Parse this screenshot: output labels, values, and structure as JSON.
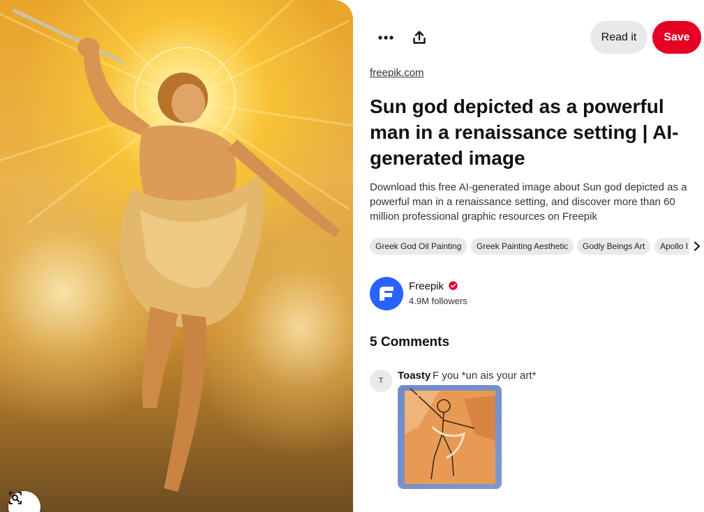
{
  "pin": {
    "image_icon": "sun-god-painting",
    "lens_icon": "visual-search-icon"
  },
  "toolbar": {
    "more_icon": "more-horizontal-icon",
    "share_icon": "share-upload-icon",
    "read_label": "Read it",
    "save_label": "Save"
  },
  "source": {
    "domain": "freepik.com"
  },
  "title": "Sun god depicted as a powerful man in a renaissance setting | AI-generated image",
  "description": "Download this free AI-generated image about Sun god depicted as a powerful man in a renaissance setting, and discover more than 60 million professional graphic resources on Freepik",
  "tags": [
    "Greek God Oil Painting",
    "Greek Painting Aesthetic",
    "Godly Beings Art",
    "Apollo I"
  ],
  "creator": {
    "name": "Freepik",
    "followers": "4.9M followers",
    "verified_icon": "verified-badge-icon"
  },
  "comments": {
    "heading": "5 Comments",
    "items": [
      {
        "avatar_initial": "T",
        "author": "Toasty",
        "text": "F you *un ais your art*"
      }
    ]
  },
  "colors": {
    "save": "#e60023",
    "pill": "#e9e9e9",
    "creator_avatar": "#2962ff"
  }
}
